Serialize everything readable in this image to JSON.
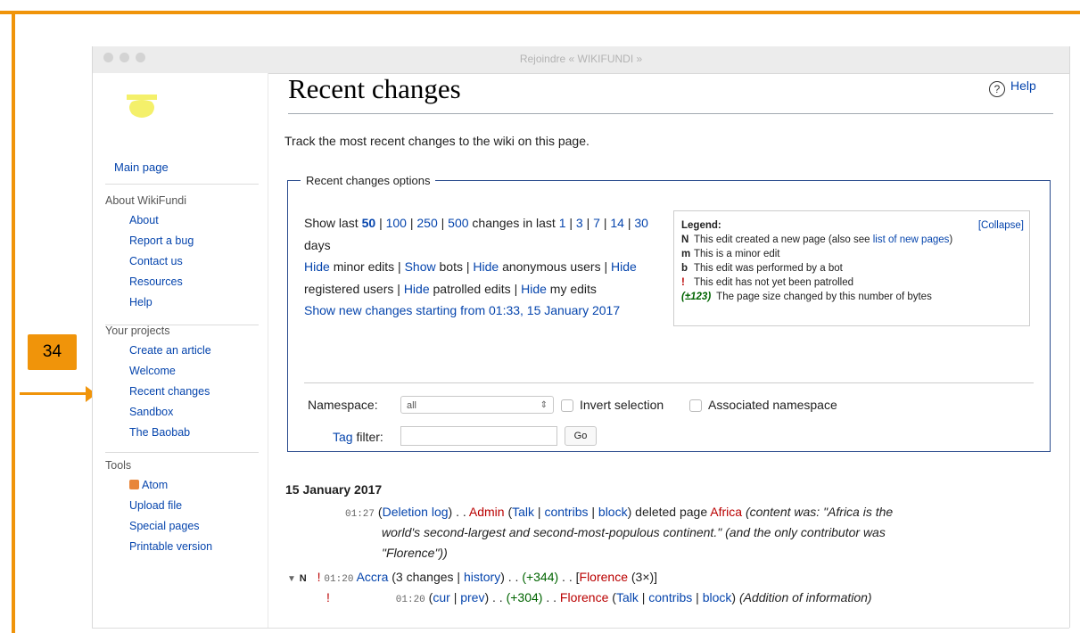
{
  "window": {
    "title": "Rejoindre « WIKIFUNDI »"
  },
  "annotation": {
    "badge": "34"
  },
  "sidebar": {
    "main_page": "Main page",
    "about": {
      "heading": "About WikiFundi",
      "items": [
        "About",
        "Report a bug",
        "Contact us",
        "Resources",
        "Help"
      ]
    },
    "projects": {
      "heading": "Your projects",
      "items": [
        "Create an article",
        "Welcome",
        "Recent changes",
        "Sandbox",
        "The Baobab"
      ]
    },
    "tools": {
      "heading": "Tools",
      "items": [
        "Atom",
        "Upload file",
        "Special pages",
        "Printable version"
      ]
    }
  },
  "page": {
    "title": "Recent changes",
    "help": "Help",
    "intro": "Track the most recent changes to the wiki on this page."
  },
  "options": {
    "legend": "Recent changes options",
    "show_last": "Show last",
    "limits": [
      "50",
      "100",
      "250",
      "500"
    ],
    "changes_in_last": "changes in last",
    "days_values": [
      "1",
      "3",
      "7",
      "14",
      "30"
    ],
    "days": "days",
    "hide": "Hide",
    "show": "Show",
    "minor_edits": "minor edits",
    "bots": "bots",
    "anonymous_users": "anonymous users",
    "registered_users": "registered users",
    "patrolled_edits": "patrolled edits",
    "my_edits": "my edits",
    "show_new_changes": "Show new changes starting from 01:33, 15 January 2017",
    "sep": "|"
  },
  "legend_box": {
    "title": "Legend:",
    "collapse": "[Collapse]",
    "items": [
      {
        "key": "N",
        "text": "This edit created a new page (also see ",
        "link": "list of new pages",
        "after": ")"
      },
      {
        "key": "m",
        "text": "This is a minor edit"
      },
      {
        "key": "b",
        "text": "This edit was performed by a bot"
      },
      {
        "key": "!",
        "text": "This edit has not yet been patrolled"
      },
      {
        "key": "(±123)",
        "text": "The page size changed by this number of bytes"
      }
    ]
  },
  "filters": {
    "namespace_label": "Namespace:",
    "namespace_value": "all",
    "invert_selection": "Invert selection",
    "associated_namespace": "Associated namespace",
    "tag_filter": "Tag",
    "filter_word": "filter:",
    "go": "Go"
  },
  "changes": {
    "date": "15 January 2017",
    "entry1": {
      "time": "01:27",
      "log": "Deletion log",
      "dots": ". .",
      "user": "Admin",
      "talk": "Talk",
      "contribs": "contribs",
      "block": "block",
      "action": "deleted page",
      "page": "Africa",
      "comment_line1": "(content was: \"Africa is the",
      "comment_line2": "world's second-largest and second-most-populous continent.\" (and the only contributor was",
      "comment_line3": "\"Florence\"))"
    },
    "entry2": {
      "flags": "N",
      "mark": "!",
      "time": "01:20",
      "page": "Accra",
      "count": "(3 changes",
      "history": "history",
      "size": "(+344)",
      "user": "Florence",
      "user_count": "(3×)]"
    },
    "entry3": {
      "mark": "!",
      "time": "01:20",
      "cur": "cur",
      "prev": "prev",
      "size": "(+304)",
      "user": "Florence",
      "talk": "Talk",
      "contribs": "contribs",
      "block": "block",
      "comment": "(Addition of information)"
    }
  }
}
